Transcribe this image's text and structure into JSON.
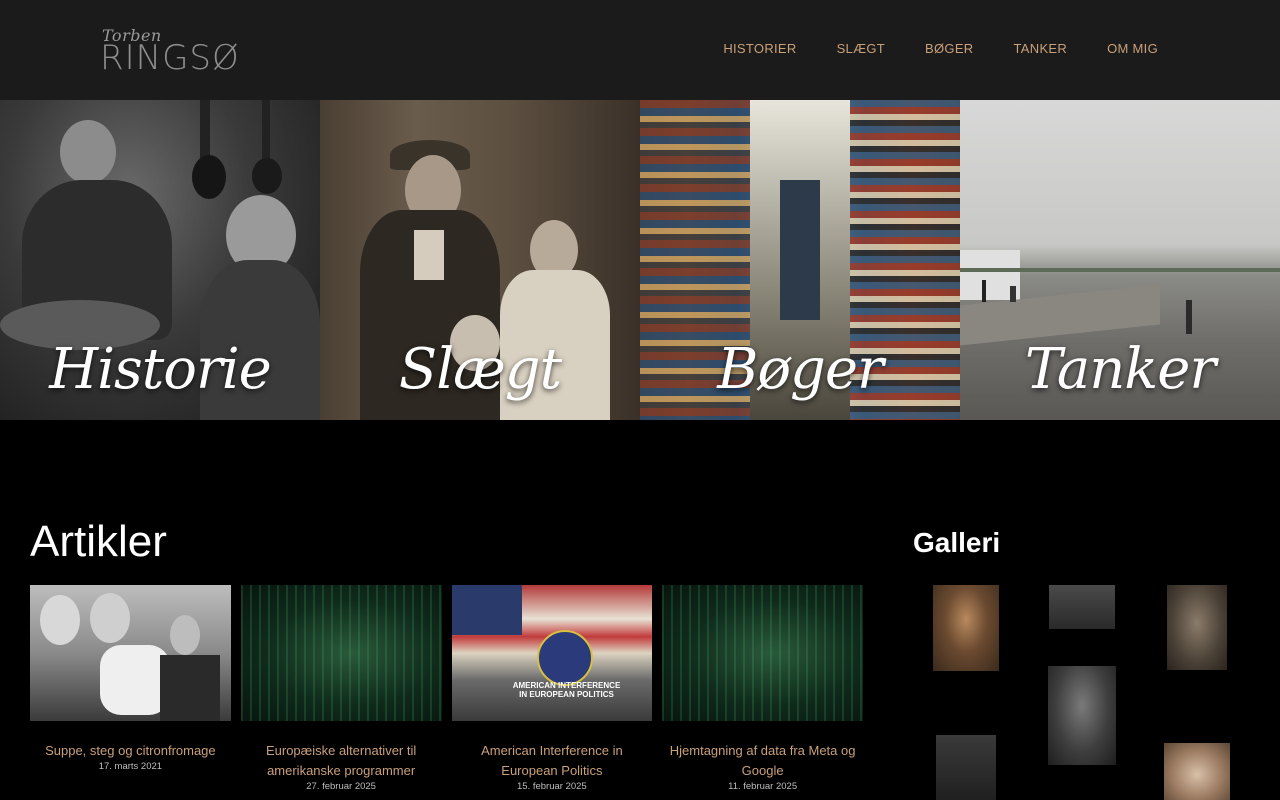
{
  "header": {
    "logo_top": "Torben",
    "logo_main": "RINGSØ",
    "nav": [
      {
        "label": "HISTORIER"
      },
      {
        "label": "SLÆGT"
      },
      {
        "label": "BØGER"
      },
      {
        "label": "TANKER"
      },
      {
        "label": "OM MIG"
      }
    ]
  },
  "hero": {
    "tiles": [
      {
        "caption": "Historie"
      },
      {
        "caption": "Slægt"
      },
      {
        "caption": "Bøger"
      },
      {
        "caption": "Tanker"
      }
    ]
  },
  "articles": {
    "title": "Artikler",
    "items": [
      {
        "title": "Suppe, steg og citronfromage",
        "date": "17. marts 2021"
      },
      {
        "title": "Europæiske alternativer til amerikanske programmer",
        "date": "27. februar 2025"
      },
      {
        "title": "American Interference in European Politics",
        "date": "15. februar 2025"
      },
      {
        "title": "Hjemtagning af data fra Meta og Google",
        "date": "11. februar 2025"
      }
    ],
    "thumb3_text": "AMERICAN INTERFERENCE IN EUROPEAN POLITICS"
  },
  "gallery": {
    "title": "Galleri"
  },
  "colors": {
    "header_bg": "#1b1b1b",
    "nav_link": "#c9a07a",
    "page_bg": "#000000"
  }
}
